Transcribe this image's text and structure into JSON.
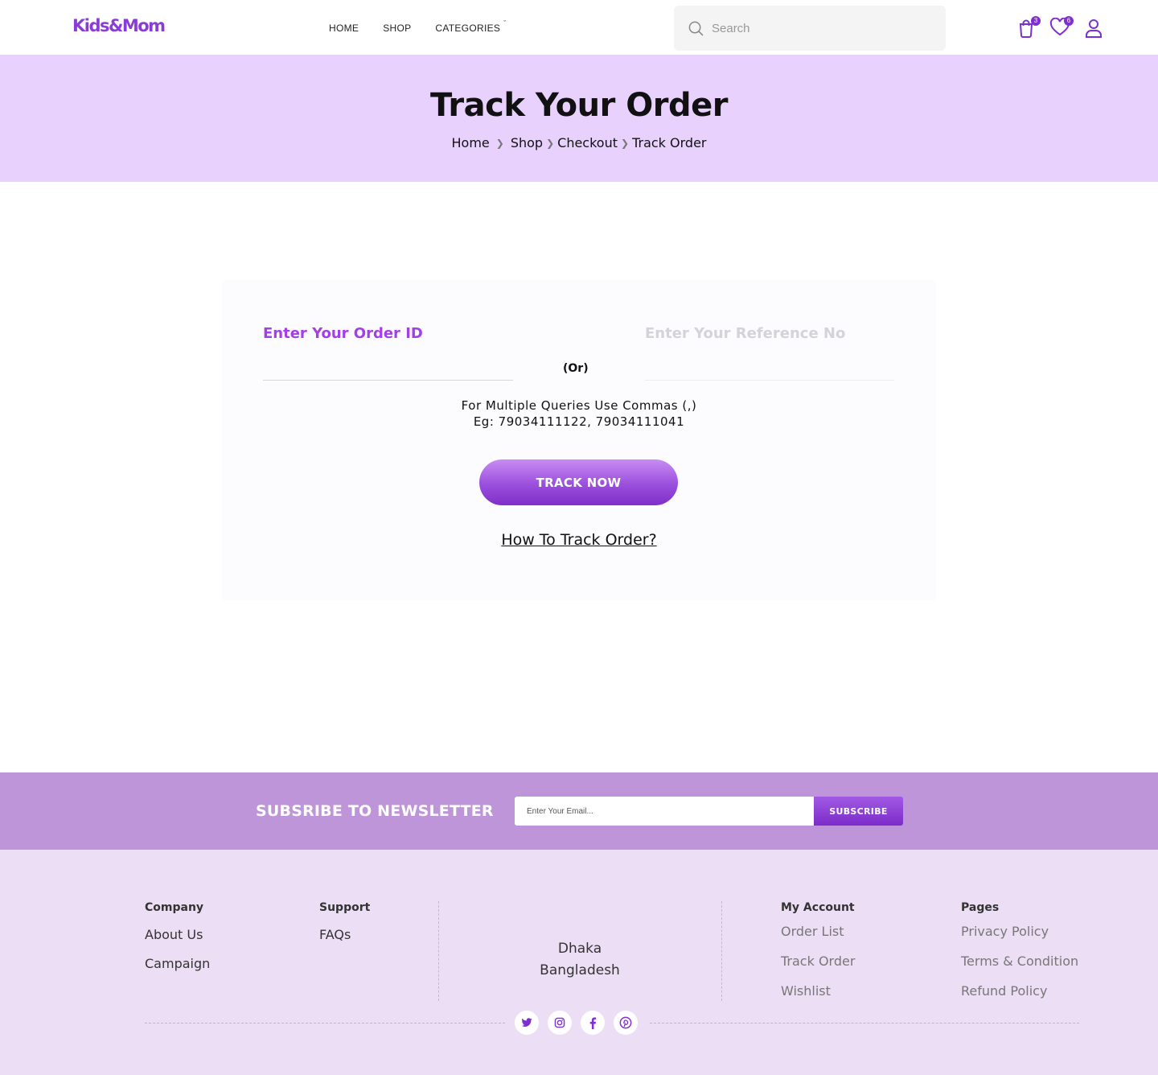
{
  "brand": {
    "logo": "Kids&Mom",
    "accent": "#8a3dd6"
  },
  "nav": {
    "home": "HOME",
    "shop": "SHOP",
    "categories": "CATEGORIES",
    "categories_chevron": "ˇ"
  },
  "search": {
    "placeholder": "Search"
  },
  "header_icons": {
    "cart_count": "3",
    "wishlist_count": "6"
  },
  "hero": {
    "title": "Track Your Order",
    "breadcrumb": [
      "Home",
      "Shop",
      "Checkout",
      "Track Order"
    ],
    "background": "#e9d1fe"
  },
  "track": {
    "order_id_label": "Enter Your Order ID",
    "or_text": "(Or)",
    "reference_label": "Enter Your Reference No",
    "hint_line1": "For Multiple Queries Use Commas (,)",
    "hint_line2": "Eg: 79034111122, 79034111041",
    "button": "TRACK NOW",
    "howto": "How To Track Order?"
  },
  "newsletter": {
    "title": "SUBSRIBE TO NEWSLETTER",
    "placeholder": "Enter Your Email...",
    "button": "SUBSCRIBE"
  },
  "footer": {
    "company": {
      "title": "Company",
      "links": [
        "About Us",
        "Campaign"
      ]
    },
    "support": {
      "title": "Support",
      "links": [
        "FAQs"
      ]
    },
    "address": {
      "line1": "Dhaka",
      "line2": "Bangladesh"
    },
    "account": {
      "title": "My Account",
      "links": [
        "Order List",
        "Track Order",
        "Wishlist"
      ]
    },
    "pages": {
      "title": "Pages",
      "links": [
        "Privacy Policy",
        "Terms & Condition",
        "Refund Policy"
      ]
    },
    "social": [
      "twitter-icon",
      "instagram-icon",
      "facebook-icon",
      "pinterest-icon"
    ]
  }
}
